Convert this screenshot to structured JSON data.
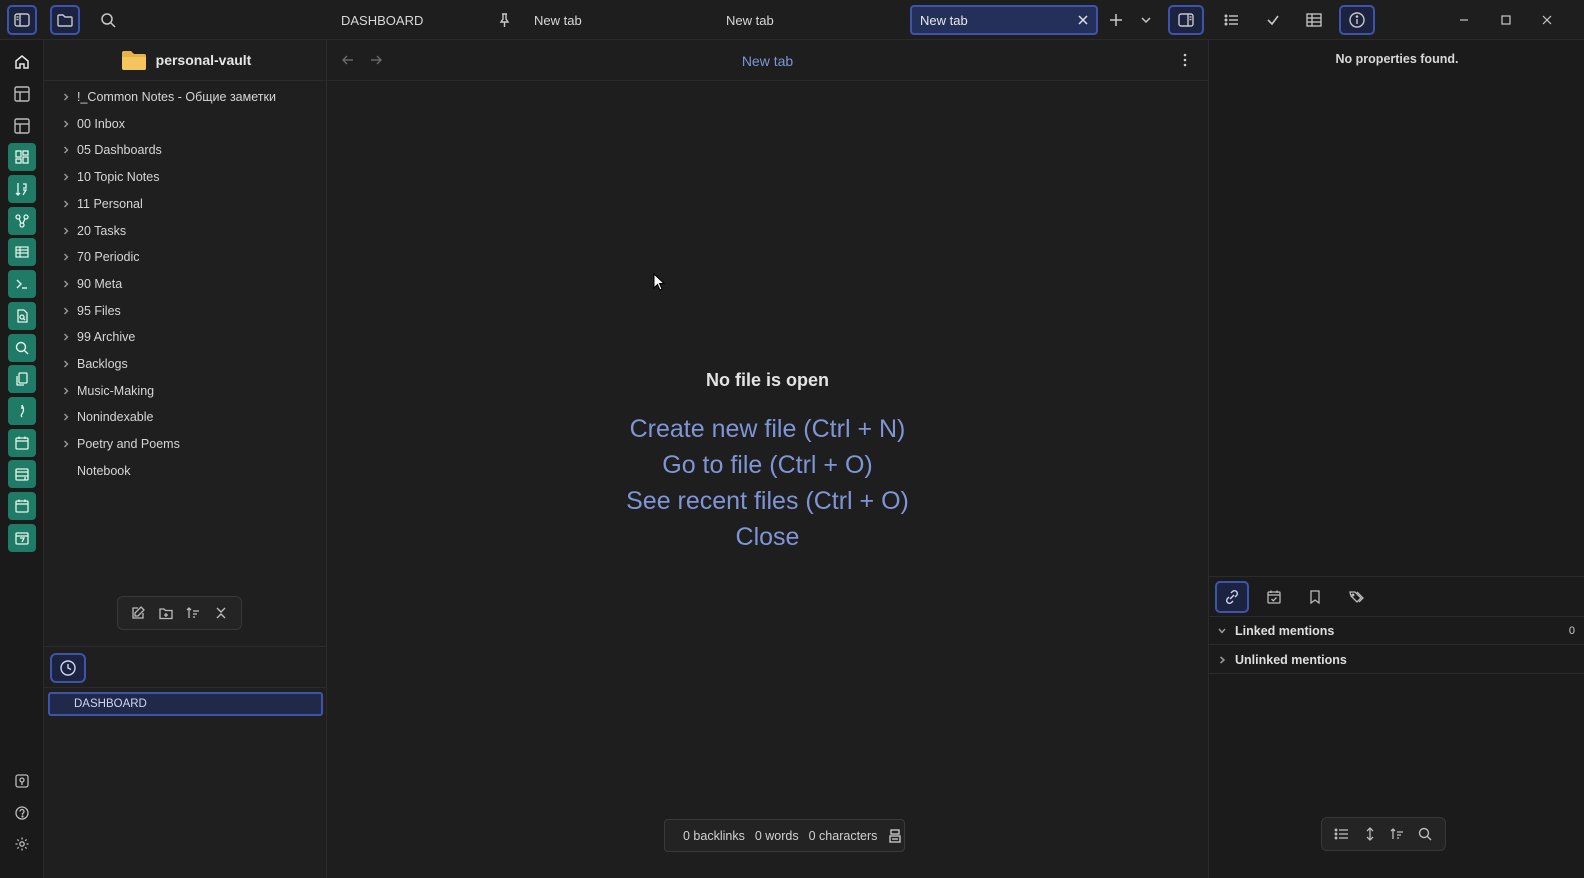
{
  "titlebar": {
    "tabs": [
      {
        "label": "DASHBOARD"
      },
      {
        "label": "New tab"
      },
      {
        "label": "New tab"
      },
      {
        "label": "New tab"
      }
    ]
  },
  "ribbon": {
    "icons": [
      "home-icon",
      "layout-icon",
      "layout-icon",
      "dashboard-icon",
      "sort-numeric-icon",
      "graph-icon",
      "table-icon",
      "terminal-icon",
      "file-search-icon",
      "search-icon",
      "copy-icon",
      "pen-icon",
      "calendar-icon",
      "calendar-plus-icon",
      "calendar-check-icon",
      "calendar-day-icon"
    ],
    "bottom_icons": [
      "vault-switch-icon",
      "help-icon",
      "settings-icon"
    ]
  },
  "sidebar": {
    "vault_name": "personal-vault",
    "folders": [
      {
        "label": "!_Common Notes - Общие заметки",
        "expandable": true
      },
      {
        "label": "00 Inbox",
        "expandable": true
      },
      {
        "label": "05 Dashboards",
        "expandable": true
      },
      {
        "label": "10 Topic Notes",
        "expandable": true
      },
      {
        "label": "11 Personal",
        "expandable": true
      },
      {
        "label": "20 Tasks",
        "expandable": true
      },
      {
        "label": "70 Periodic",
        "expandable": true
      },
      {
        "label": "90 Meta",
        "expandable": true
      },
      {
        "label": "95 Files",
        "expandable": true
      },
      {
        "label": "99 Archive",
        "expandable": true
      },
      {
        "label": "Backlogs",
        "expandable": true
      },
      {
        "label": "Music-Making",
        "expandable": true
      },
      {
        "label": "Nonindexable",
        "expandable": true
      },
      {
        "label": "Poetry and Poems",
        "expandable": true
      },
      {
        "label": "Notebook",
        "expandable": false
      }
    ],
    "recent_files": [
      {
        "label": "DASHBOARD"
      }
    ]
  },
  "main": {
    "title": "New tab",
    "empty": {
      "title": "No file is open",
      "actions": [
        "Create new file (Ctrl + N)",
        "Go to file (Ctrl + O)",
        "See recent files (Ctrl + O)",
        "Close"
      ]
    },
    "status": {
      "backlinks": "0 backlinks",
      "words": "0 words",
      "characters": "0 characters"
    }
  },
  "right": {
    "no_properties": "No properties found.",
    "linked_mentions": {
      "label": "Linked mentions",
      "count": "0"
    },
    "unlinked_mentions": {
      "label": "Unlinked mentions"
    }
  },
  "colors": {
    "accent": "#7f95d6",
    "ribbon_teal": "#1f7a66",
    "active_border": "#3d54a8"
  }
}
